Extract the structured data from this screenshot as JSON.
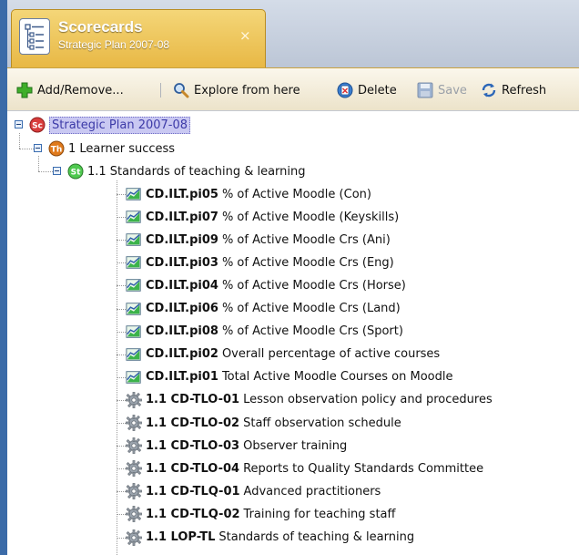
{
  "tab": {
    "title": "Scorecards",
    "subtitle": "Strategic Plan 2007-08",
    "close_glyph": "×",
    "icon": "scorecard-document-icon"
  },
  "toolbar": {
    "add_remove": "Add/Remove...",
    "explore": "Explore from here",
    "delete": "Delete",
    "save": "Save",
    "refresh": "Refresh",
    "icons": {
      "add_remove": "green-plus-icon",
      "explore": "magnifier-icon",
      "delete": "delete-icon",
      "save": "floppy-disk-icon",
      "refresh": "refresh-arrows-icon"
    }
  },
  "tree": {
    "root": {
      "badge": "Sc",
      "label": "Strategic Plan 2007-08",
      "badge_color": "#d83c3c"
    },
    "theme": {
      "badge": "Th",
      "label": "1 Learner success",
      "badge_color": "#e07a1c"
    },
    "standard": {
      "badge": "St",
      "label": "1.1 Standards of teaching & learning",
      "badge_color": "#4fc94f"
    },
    "items": [
      {
        "type": "indicator",
        "code": "CD.ILT.pi05",
        "label": "% of Active Moodle (Con)"
      },
      {
        "type": "indicator",
        "code": "CD.ILT.pi07",
        "label": "% of Active Moodle (Keyskills)"
      },
      {
        "type": "indicator",
        "code": "CD.ILT.pi09",
        "label": "% of Active Moodle Crs (Ani)"
      },
      {
        "type": "indicator",
        "code": "CD.ILT.pi03",
        "label": "% of Active Moodle Crs (Eng)"
      },
      {
        "type": "indicator",
        "code": "CD.ILT.pi04",
        "label": "% of Active Moodle Crs (Horse)"
      },
      {
        "type": "indicator",
        "code": "CD.ILT.pi06",
        "label": "% of Active Moodle Crs (Land)"
      },
      {
        "type": "indicator",
        "code": "CD.ILT.pi08",
        "label": "% of Active Moodle Crs (Sport)"
      },
      {
        "type": "indicator",
        "code": "CD.ILT.pi02",
        "label": "Overall percentage of active courses"
      },
      {
        "type": "indicator",
        "code": "CD.ILT.pi01",
        "label": "Total Active Moodle Courses on Moodle"
      },
      {
        "type": "action",
        "code": "1.1 CD-TLO-01",
        "label": "Lesson observation policy and procedures"
      },
      {
        "type": "action",
        "code": "1.1 CD-TLO-02",
        "label": "Staff observation schedule"
      },
      {
        "type": "action",
        "code": "1.1 CD-TLO-03",
        "label": "Observer training"
      },
      {
        "type": "action",
        "code": "1.1 CD-TLO-04",
        "label": "Reports to Quality Standards Committee"
      },
      {
        "type": "action",
        "code": "1.1 CD-TLQ-01",
        "label": "Advanced practitioners"
      },
      {
        "type": "action",
        "code": "1.1 CD-TLQ-02",
        "label": "Training for teaching staff"
      },
      {
        "type": "action",
        "code": "1.1 LOP-TL",
        "label": "Standards of teaching & learning"
      }
    ],
    "icons": {
      "indicator": "performance-chart-icon",
      "action": "gear-icon"
    }
  },
  "colors": {
    "window_edge": "#3b6ba8",
    "tab_gold": "#e8b845",
    "selection": "#c9c8f2",
    "selection_text": "#3c3aa8"
  }
}
